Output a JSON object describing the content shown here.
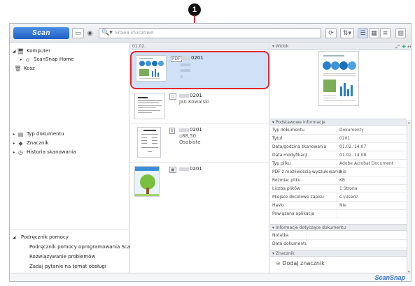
{
  "callout_number": "1",
  "toolbar": {
    "scan_label": "Scan",
    "search_placeholder": "Słowa kluczowe"
  },
  "tree": {
    "computer": "Komputer",
    "home": "ScanSnap Home",
    "trash": "Kosz",
    "doc_type": "Typ dokumentu",
    "tag": "Znacznik",
    "history": "Historia skanowania"
  },
  "help": {
    "title": "Podręcznik pomocy",
    "items": [
      "Podręcznik pomocy oprogramowania ScanSnap",
      "Rozwiązywanie problemów",
      "Zadaj pytanie na temat obsługi"
    ]
  },
  "list": {
    "date_header": "01.02.",
    "items": [
      {
        "name": "0201",
        "sub1": "",
        "sub2": ""
      },
      {
        "name": "0201",
        "sub1": "Jan Kowalski",
        "sub2": ""
      },
      {
        "name": "0201",
        "sub1": "88,50",
        "sub2": "Osobiste"
      },
      {
        "name": "0201",
        "sub1": "",
        "sub2": ""
      }
    ]
  },
  "right": {
    "view_label": "Widok",
    "basic_section": "Podstawowe informacje",
    "props": [
      {
        "k": "Typ dokumentu",
        "v": "Dokumenty"
      },
      {
        "k": "Tytuł",
        "v": "0201"
      },
      {
        "k": "Data/godzina skanowania",
        "v": "01.02.      14:07"
      },
      {
        "k": "Data modyfikacji",
        "v": "01.02.      14:08"
      },
      {
        "k": "Typ pliku",
        "v": "Adobe Acrobat Document"
      },
      {
        "k": "PDF z możliwością wyszukiwania",
        "v": "Nie"
      },
      {
        "k": "Rozmiar pliku",
        "v": "KB"
      },
      {
        "k": "Liczba plików",
        "v": "1 Strona"
      },
      {
        "k": "Miejsce docelowe zapisu",
        "v": "C:\\Users\\"
      },
      {
        "k": "Hasło",
        "v": "Nie"
      },
      {
        "k": "Powiązana aplikacja",
        "v": ""
      }
    ],
    "doc_section": "Informacje dotyczące dokumentu",
    "doc_props": [
      {
        "k": "Notatka",
        "v": ""
      },
      {
        "k": "Data dokumentu",
        "v": ""
      }
    ],
    "tag_section": "Znacznik",
    "add_tag": "Dodaj znacznik"
  },
  "status": {
    "logo": "ScanSnap"
  },
  "colors": {
    "accent": "#1f5fc2",
    "selection": "#cfe0f7",
    "callout_red": "#e3262b"
  }
}
